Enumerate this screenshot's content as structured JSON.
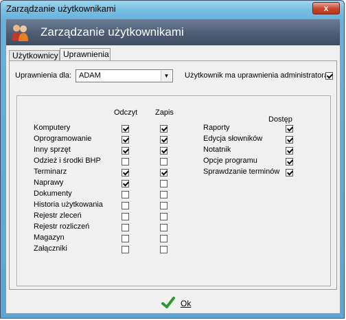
{
  "window": {
    "title": "Zarządzanie użytkownikami",
    "close": "x"
  },
  "header": {
    "title": "Zarządzanie użytkownikami",
    "icon": "users-icon"
  },
  "tabs": [
    "Użytkownicy",
    "Uprawnienia"
  ],
  "form": {
    "perm_for_label": "Uprawnienia dla:",
    "user_value": "ADAM",
    "admin_label": "Użytkownik ma uprawnienia administratora",
    "admin_checked": true
  },
  "columns": {
    "read": "Odczyt",
    "write": "Zapis",
    "access": "Dostęp"
  },
  "left_rows": [
    {
      "label": "Komputery",
      "read": true,
      "write": true
    },
    {
      "label": "Oprogramowanie",
      "read": true,
      "write": true
    },
    {
      "label": "Inny sprzęt",
      "read": true,
      "write": true
    },
    {
      "label": "Odzież i środki BHP",
      "read": false,
      "write": false
    },
    {
      "label": "Terminarz",
      "read": true,
      "write": true
    },
    {
      "label": "Naprawy",
      "read": true,
      "write": false
    },
    {
      "label": "Dokumenty",
      "read": false,
      "write": false
    },
    {
      "label": "Historia użytkowania",
      "read": false,
      "write": false
    },
    {
      "label": "Rejestr zleceń",
      "read": false,
      "write": false
    },
    {
      "label": "Rejestr rozliczeń",
      "read": false,
      "write": false
    },
    {
      "label": "Magazyn",
      "read": false,
      "write": false
    },
    {
      "label": "Załączniki",
      "read": false,
      "write": false
    }
  ],
  "right_rows": [
    {
      "label": "Raporty",
      "access": true
    },
    {
      "label": "Edycja słowników",
      "access": true
    },
    {
      "label": "Notatnik",
      "access": true
    },
    {
      "label": "Opcje programu",
      "access": true
    },
    {
      "label": "Sprawdzanie terminów",
      "access": true
    }
  ],
  "footer": {
    "ok_label": "Ok"
  }
}
